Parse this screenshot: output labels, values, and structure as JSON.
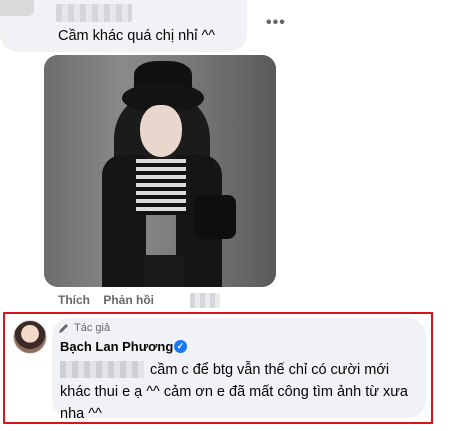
{
  "top_comment": {
    "text": "Cầm khác quá chị nhỉ ^^",
    "more_label": "•••"
  },
  "actions": {
    "like_label": "Thích",
    "reply_label": "Phản hồi"
  },
  "reply": {
    "author_tag": "Tác giả",
    "author_name": "Bạch Lan Phương",
    "verified_mark": "✓",
    "text": "cầm c để btg vẫn thế chỉ có cười mới khác thui e ạ ^^ cảm ơn e đã mất công tìm ảnh từ xưa nha ^^"
  },
  "colors": {
    "highlight_border": "#d9141b",
    "bubble_bg": "#f0f2f5",
    "verified": "#1877f2",
    "secondary_text": "#65676b"
  },
  "icons": {
    "pencil": "pencil-icon",
    "verified": "verified-badge-icon",
    "more": "more-options-icon"
  }
}
